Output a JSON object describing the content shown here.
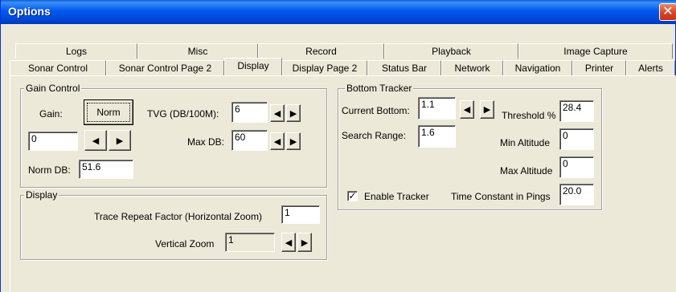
{
  "window": {
    "title": "Options",
    "close_glyph": "✕"
  },
  "tabs": {
    "row1": [
      "Logs",
      "Misc",
      "Record",
      "Playback",
      "Image Capture"
    ],
    "row2": [
      "Sonar Control",
      "Sonar Control Page 2",
      "Display",
      "Display Page 2",
      "Status Bar",
      "Network",
      "Navigation",
      "Printer",
      "Alerts"
    ],
    "selected": "Display"
  },
  "gain_control": {
    "title": "Gain Control",
    "gain_label": "Gain:",
    "norm_button": "Norm",
    "gain_value": "0",
    "norm_db_label": "Norm DB:",
    "norm_db_value": "51.6",
    "tvg_label": "TVG (DB/100M):",
    "tvg_value": "6",
    "max_db_label": "Max DB:",
    "max_db_value": "60"
  },
  "display_group": {
    "title": "Display",
    "trace_label": "Trace Repeat Factor (Horizontal Zoom)",
    "trace_value": "1",
    "vertical_zoom_label": "Vertical Zoom",
    "vertical_zoom_value": "1"
  },
  "bottom_tracker": {
    "title": "Bottom Tracker",
    "current_bottom_label": "Current Bottom:",
    "current_bottom_value": "1.1",
    "search_range_label": "Search Range:",
    "search_range_value": "1.6",
    "threshold_label": "Threshold %",
    "threshold_value": "28.4",
    "min_altitude_label": "Min Altitude",
    "min_altitude_value": "0",
    "max_altitude_label": "Max Altitude",
    "max_altitude_value": "0",
    "enable_tracker_label": "Enable Tracker",
    "enable_tracker_checked": true,
    "time_constant_label": "Time Constant in Pings",
    "time_constant_value": "20.0"
  },
  "arrows": {
    "left": "◀",
    "right": "▶"
  }
}
